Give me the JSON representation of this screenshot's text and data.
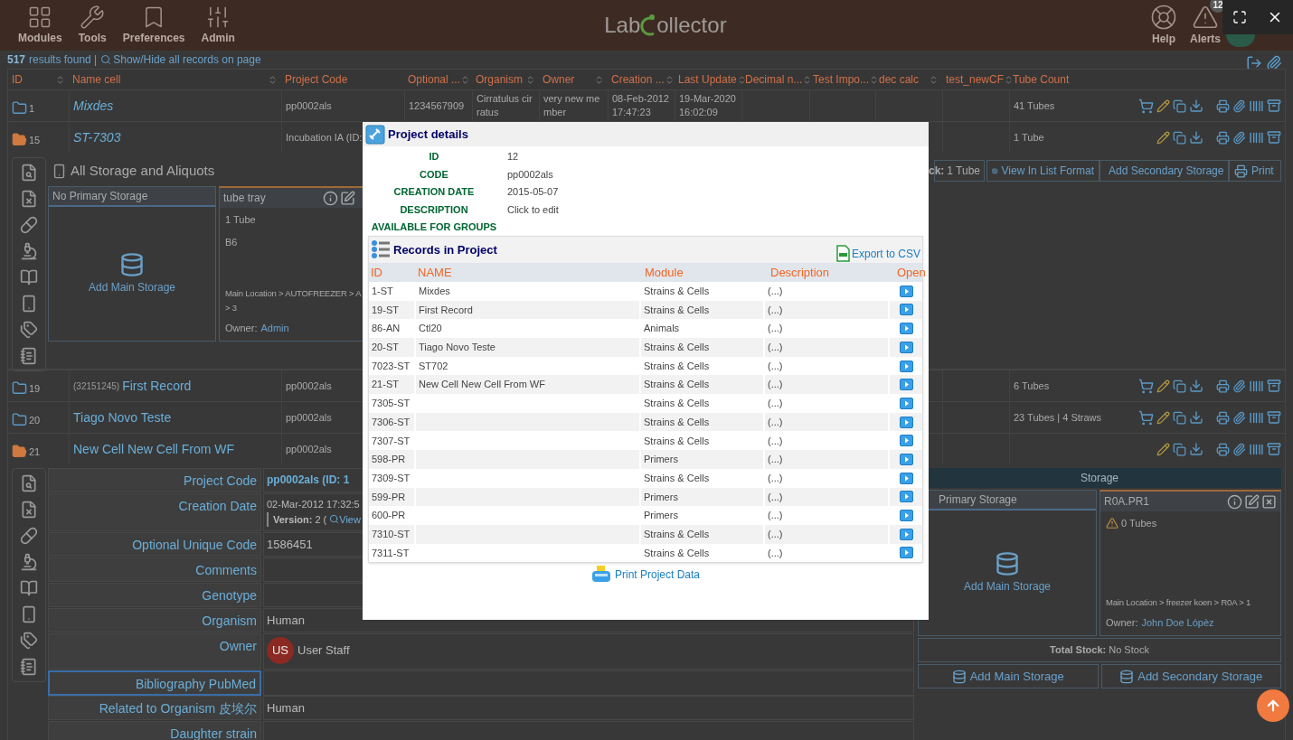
{
  "header": {
    "nav": [
      {
        "label": "Modules"
      },
      {
        "label": "Tools"
      },
      {
        "label": "Preferences"
      },
      {
        "label": "Admin"
      }
    ],
    "logo_left": "Lab",
    "logo_right": "ollector",
    "right": [
      {
        "label": "Help"
      },
      {
        "label": "Alerts",
        "badge": "12"
      }
    ]
  },
  "results": {
    "count": "517",
    "text": "results found |",
    "link": "Show/Hide all records on page"
  },
  "table": {
    "columns": [
      "ID",
      "Name cell",
      "Project Code",
      "Optional ...",
      "Organism",
      "Owner",
      "Creation ...",
      "Last Update",
      "Decimal n...",
      "Test Impo...",
      "dec calc",
      "test_newCF",
      "Tube Count"
    ],
    "rows": [
      {
        "id": "1",
        "expanded": false,
        "italic": true,
        "cart": true,
        "name": "Mixdes",
        "cells": {
          "project_code": "pp0002als",
          "optional_code": "1234567909",
          "organism": "Cirratulus cirratus",
          "owner": "very new member",
          "creation": "08-Feb-2012 17:47:23",
          "last_update": "19-Mar-2020 16:02:09"
        },
        "tube_count": "41 Tubes"
      },
      {
        "id": "15",
        "expanded": true,
        "italic": true,
        "cart": false,
        "name": "ST-7303",
        "cells": {
          "project_code": "Incubation IA (ID:"
        },
        "tube_count": "1 Tube",
        "panel": {
          "kind": "aliquots",
          "title": "All Storage and Aliquots",
          "stock_label": "ck:",
          "stock_value": "1 Tube",
          "buttons": [
            "View In List Format",
            "Add Secondary Storage",
            "Print"
          ],
          "primary": {
            "title": "No Primary Storage",
            "action": "Add Main Storage"
          },
          "secondary": {
            "title": "tube tray",
            "count": "1 Tube",
            "position": "B6",
            "location": [
              "Main Location > AUTOFREEZER > A",
              "> 3"
            ],
            "owner_label": "Owner:",
            "owner": "Admin"
          }
        }
      },
      {
        "id": "19",
        "expanded": false,
        "italic": false,
        "cart": true,
        "code": "(32151245)",
        "name": "First Record",
        "cells": {
          "project_code": "pp0002als"
        },
        "tube_count": "6 Tubes"
      },
      {
        "id": "20",
        "expanded": false,
        "italic": false,
        "cart": true,
        "name": "Tiago Novo Teste",
        "cells": {
          "project_code": "pp0002als"
        },
        "tube_count": "23 Tubes | 4 Straws"
      },
      {
        "id": "21",
        "expanded": true,
        "italic": false,
        "cart": false,
        "name": "New Cell New Cell From WF",
        "cells": {
          "project_code": "pp0002als"
        },
        "panel": {
          "kind": "record",
          "fields": [
            {
              "kind": "link",
              "label": "Project Code",
              "value": "pp0002als (ID: 1"
            },
            {
              "kind": "version",
              "label": "Creation Date",
              "value": "02-Mar-2012 17:32:5",
              "version_label": "Version:",
              "version": "2 (",
              "version_link": "View"
            },
            {
              "kind": "text",
              "label": "Optional Unique Code",
              "value": "1586451"
            },
            {
              "kind": "text",
              "label": "Comments"
            },
            {
              "kind": "text",
              "label": "Genotype"
            },
            {
              "kind": "text",
              "label": "Organism",
              "value": "Human"
            },
            {
              "kind": "user",
              "label": "Owner",
              "initials": "US",
              "value": "User Staff"
            },
            {
              "kind": "text",
              "label": "Bibliography PubMed",
              "focused": true
            },
            {
              "kind": "text",
              "label": "Related to Organism 皮埃尔",
              "value": "Human"
            },
            {
              "kind": "text",
              "label": "Daughter strain"
            }
          ],
          "storage": {
            "title": "Storage",
            "primary": {
              "title": "Primary Storage",
              "action": "Add Main Storage"
            },
            "secondary": {
              "title": "R0A.PR1",
              "count": "0 Tubes",
              "location": "Main Location > freezer koen > R0A > 1",
              "owner_label": "Owner:",
              "owner": "John Doe Lópèz"
            },
            "total_label": "Total Stock:",
            "total": "No Stock",
            "buttons": [
              "Add Main Storage",
              "Add Secondary Storage"
            ]
          }
        }
      }
    ]
  },
  "modal": {
    "title": "Project details",
    "fields": [
      {
        "label": "ID",
        "value": "12"
      },
      {
        "label": "CODE",
        "value": "pp0002als"
      },
      {
        "label": "CREATION DATE",
        "value": "2015-05-07"
      },
      {
        "label": "DESCRIPTION",
        "value": "Click to edit"
      },
      {
        "label": "AVAILABLE FOR GROUPS"
      }
    ],
    "records": {
      "title": "Records in Project",
      "export": "Export to CSV",
      "columns": [
        "ID",
        "NAME",
        "Module",
        "Description",
        "Open"
      ],
      "rows": [
        {
          "id": "1-ST",
          "name": "Mixdes",
          "module": "Strains & Cells",
          "description": "(...)"
        },
        {
          "id": "19-ST",
          "name": "First Record",
          "module": "Strains & Cells",
          "description": "(...)"
        },
        {
          "id": "86-AN",
          "name": "Ctl20",
          "module": "Animals",
          "description": "(...)"
        },
        {
          "id": "20-ST",
          "name": "Tiago Novo Teste",
          "module": "Strains & Cells",
          "description": "(...)"
        },
        {
          "id": "7023-ST",
          "name": "ST702",
          "module": "Strains & Cells",
          "description": "(...)"
        },
        {
          "id": "21-ST",
          "name": "New Cell New Cell From WF",
          "module": "Strains & Cells",
          "description": "(...)"
        },
        {
          "id": "7305-ST",
          "module": "Strains & Cells",
          "description": "(...)"
        },
        {
          "id": "7306-ST",
          "module": "Strains & Cells",
          "description": "(...)"
        },
        {
          "id": "7307-ST",
          "module": "Strains & Cells",
          "description": "(...)"
        },
        {
          "id": "598-PR",
          "module": "Primers",
          "description": "(...)"
        },
        {
          "id": "7309-ST",
          "module": "Strains & Cells",
          "description": "(...)"
        },
        {
          "id": "599-PR",
          "module": "Primers",
          "description": "(...)"
        },
        {
          "id": "600-PR",
          "module": "Primers",
          "description": "(...)"
        },
        {
          "id": "7310-ST",
          "module": "Strains & Cells",
          "description": "(...)"
        },
        {
          "id": "7311-ST",
          "module": "Strains & Cells",
          "description": "(...)"
        }
      ]
    },
    "print": "Print Project Data"
  }
}
